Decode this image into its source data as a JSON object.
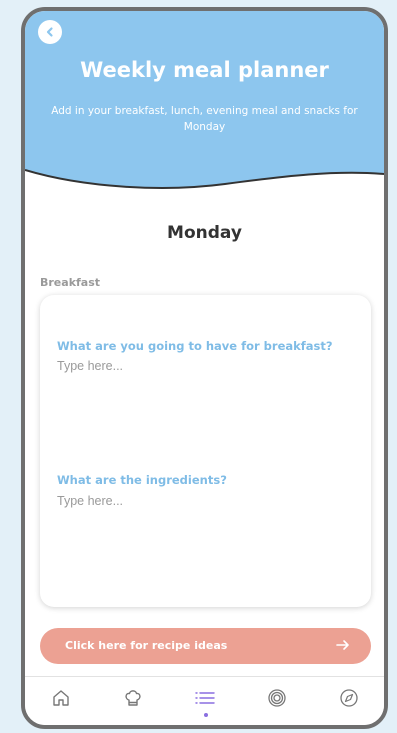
{
  "header": {
    "title": "Weekly meal planner",
    "subtitle": "Add in your breakfast, lunch, evening meal and snacks for Monday",
    "color": "#8dc6ee"
  },
  "day": "Monday",
  "breakfast": {
    "section_label": "Breakfast",
    "question_meal": "What are you going to have for breakfast?",
    "meal_placeholder": "Type here...",
    "question_ingredients": "What are the ingredients?",
    "ingredients_placeholder": "Type here..."
  },
  "recipe_button": {
    "label": "Click here for recipe ideas",
    "color": "#eca193"
  },
  "bottom_nav": {
    "items": [
      "home-icon",
      "chef-hat-icon",
      "list-icon",
      "target-icon",
      "compass-icon"
    ],
    "active": "list-icon",
    "active_color": "#8a6fe0"
  }
}
